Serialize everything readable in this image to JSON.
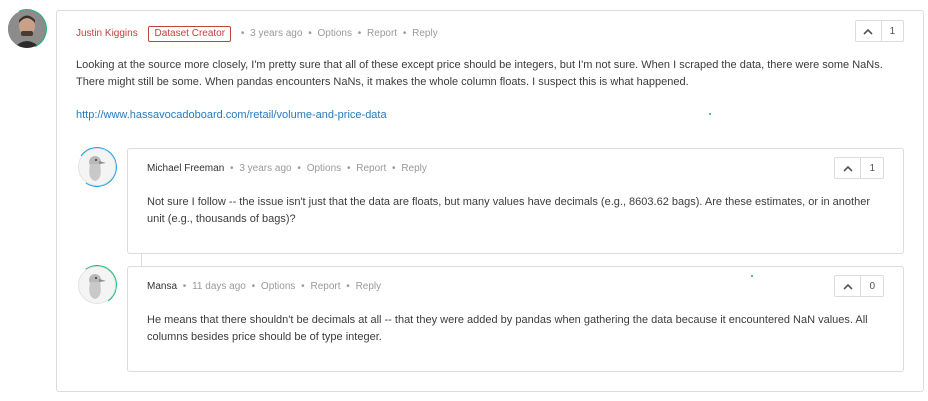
{
  "comments": [
    {
      "author": "Justin Kiggins",
      "badge": "Dataset Creator",
      "time": "3 years ago",
      "options": "Options",
      "report": "Report",
      "reply": "Reply",
      "votes": "1",
      "body": "Looking at the source more closely, I'm pretty sure that all of these except price should be integers, but I'm not sure. When I scraped the data, there were some NaNs. There might still be some. When pandas encounters NaNs, it makes the whole column floats. I suspect this is what happened.",
      "link": "http://www.hassavocadoboard.com/retail/volume-and-price-data"
    },
    {
      "author": "Michael Freeman",
      "time": "3 years ago",
      "options": "Options",
      "report": "Report",
      "reply": "Reply",
      "votes": "1",
      "body": "Not sure I follow -- the issue isn't just that the data are floats, but many values have decimals (e.g., 8603.62 bags). Are these estimates, or in another unit (e.g., thousands of bags)?"
    },
    {
      "author": "Mansa",
      "time": "11 days ago",
      "options": "Options",
      "report": "Report",
      "reply": "Reply",
      "votes": "0",
      "body": "He means that there shouldn't be decimals at all -- that they were added by pandas when gathering the data because it encountered NaN values. All columns besides price should be of type integer."
    }
  ],
  "separator": "•",
  "icons": {
    "upvote": "chevron-up-icon"
  },
  "colors": {
    "author_red": "#c2423c",
    "link": "#2a7ab9",
    "ring_green": "#20b87a",
    "ring_blue": "#1aa3e8"
  }
}
